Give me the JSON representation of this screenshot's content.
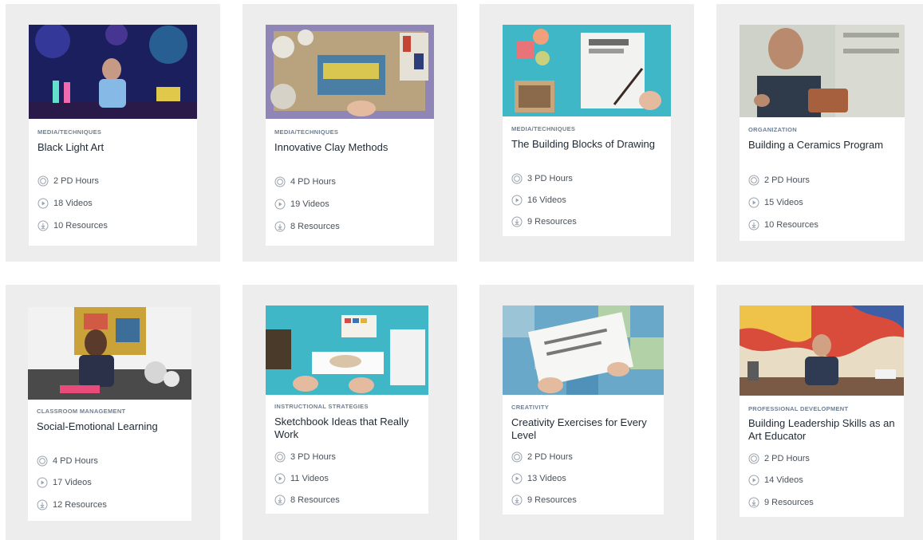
{
  "courses": [
    {
      "category": "MEDIA/TECHNIQUES",
      "title": "Black Light Art",
      "pd_hours": "2 PD Hours",
      "videos": "18 Videos",
      "resources": "10 Resources"
    },
    {
      "category": "MEDIA/TECHNIQUES",
      "title": "Innovative Clay Methods",
      "pd_hours": "4 PD Hours",
      "videos": "19 Videos",
      "resources": "8 Resources"
    },
    {
      "category": "MEDIA/TECHNIQUES",
      "title": "The Building Blocks of Drawing",
      "pd_hours": "3 PD Hours",
      "videos": "16 Videos",
      "resources": "9 Resources"
    },
    {
      "category": "ORGANIZATION",
      "title": "Building a Ceramics Program",
      "pd_hours": "2 PD Hours",
      "videos": "15 Videos",
      "resources": "10 Resources"
    },
    {
      "category": "CLASSROOM MANAGEMENT",
      "title": "Social-Emotional Learning",
      "pd_hours": "4 PD Hours",
      "videos": "17 Videos",
      "resources": "12 Resources"
    },
    {
      "category": "INSTRUCTIONAL STRATEGIES",
      "title": "Sketchbook Ideas that Really Work",
      "pd_hours": "3 PD Hours",
      "videos": "11 Videos",
      "resources": "8 Resources"
    },
    {
      "category": "CREATIVITY",
      "title": "Creativity Exercises for Every Level",
      "pd_hours": "2 PD Hours",
      "videos": "13 Videos",
      "resources": "9 Resources"
    },
    {
      "category": "PROFESSIONAL DEVELOPMENT",
      "title": "Building Leadership Skills as an Art Educator",
      "pd_hours": "2 PD Hours",
      "videos": "14 Videos",
      "resources": "9 Resources"
    }
  ],
  "icons": {
    "pd_hours": "badge-icon",
    "videos": "play-icon",
    "resources": "download-icon"
  },
  "colors": {
    "tile_bg": "#ededed",
    "card_bg": "#ffffff",
    "icon": "#9aa3ad",
    "category": "#6f7f93"
  }
}
